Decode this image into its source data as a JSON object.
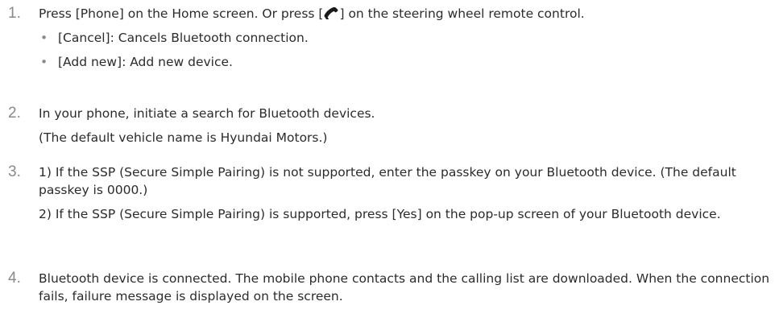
{
  "steps": [
    {
      "number": "1.",
      "text_before": "Press [Phone] on the Home screen. Or press [",
      "icon": "phone-handset-icon",
      "text_after": "] on the steering wheel remote control.",
      "bullets": [
        "[Cancel]: Cancels Bluetooth connection.",
        "[Add new]: Add new device."
      ]
    },
    {
      "number": "2.",
      "lines": [
        "In your phone, initiate a search for Bluetooth devices.",
        "(The default vehicle name is Hyundai Motors.)"
      ]
    },
    {
      "number": "3.",
      "paragraphs": [
        "1) If the SSP (Secure Simple Pairing) is not supported, enter the passkey on your Bluetooth device. (The default passkey is 0000.)",
        "2) If the SSP (Secure Simple Pairing) is supported, press [Yes] on the pop-up screen of your Bluetooth device."
      ]
    },
    {
      "number": "4.",
      "paragraphs": [
        "Bluetooth device is connected. The mobile phone contacts and the calling list are downloaded. When the connection fails, failure message is displayed on the screen."
      ]
    }
  ],
  "bullet_symbol": "•"
}
